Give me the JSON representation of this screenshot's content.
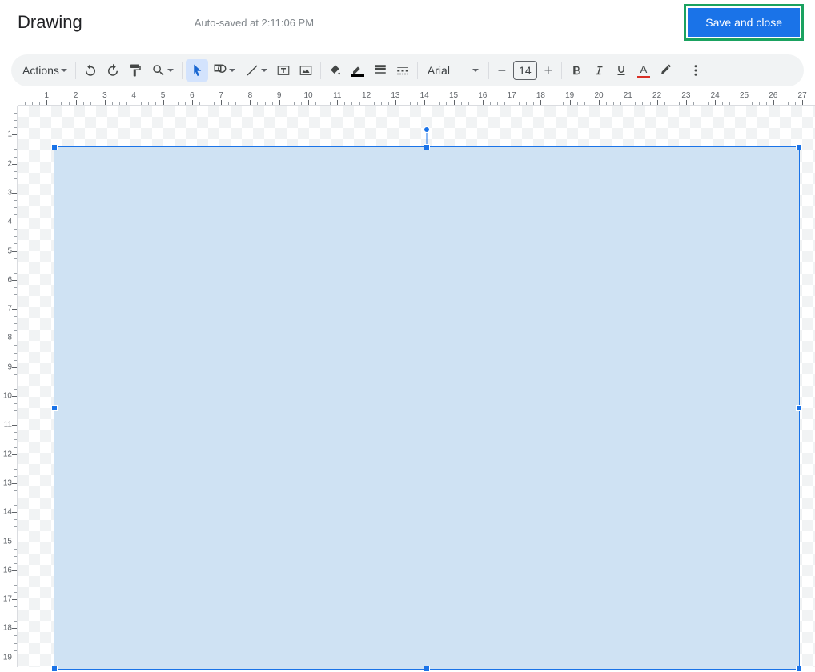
{
  "header": {
    "title": "Drawing",
    "autosave": "Auto-saved at 2:11:06 PM",
    "save_button": "Save and close"
  },
  "toolbar": {
    "actions_label": "Actions",
    "font_name": "Arial",
    "font_size": "14"
  },
  "ruler": {
    "h_labels": [
      "1",
      "2",
      "3",
      "4",
      "5",
      "6",
      "7",
      "8",
      "9",
      "10",
      "11",
      "12",
      "13",
      "14",
      "15",
      "16",
      "17",
      "18",
      "19",
      "20",
      "21",
      "22",
      "23",
      "24",
      "25",
      "26",
      "27"
    ],
    "v_labels": [
      "1",
      "2",
      "3",
      "4",
      "5",
      "6",
      "7",
      "8",
      "9",
      "10",
      "11",
      "12",
      "13",
      "14",
      "15",
      "16",
      "17",
      "18",
      "19"
    ]
  },
  "shape": {
    "fill_color": "#cfe2f3",
    "stroke_color": "#1a73e8"
  },
  "highlight_color": "#1aa260"
}
